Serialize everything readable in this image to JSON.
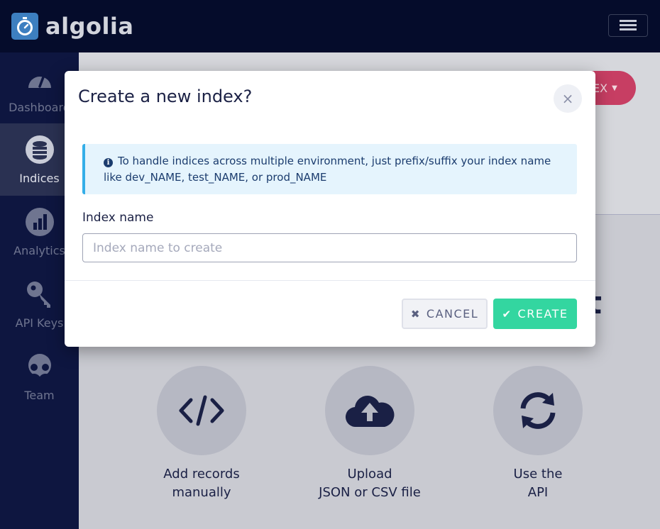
{
  "app": {
    "logo_text": "algolia",
    "menu_icon": "hamburger-menu-icon"
  },
  "sidebar": {
    "items": [
      {
        "label": "Dashboard",
        "icon": "gauge-icon"
      },
      {
        "label": "Indices",
        "icon": "database-icon"
      },
      {
        "label": "Analytics",
        "icon": "bar-chart-icon"
      },
      {
        "label": "API Keys",
        "icon": "key-icon"
      },
      {
        "label": "Team",
        "icon": "users-icon"
      }
    ]
  },
  "background": {
    "new_index_button": "EX",
    "heading_fragment": "t",
    "options": [
      {
        "line1": "Add records",
        "line2": "manually",
        "icon": "code-icon"
      },
      {
        "line1": "Upload",
        "line2": "JSON or CSV file",
        "icon": "cloud-upload-icon"
      },
      {
        "line1": "Use the",
        "line2": "API",
        "icon": "sync-icon"
      }
    ]
  },
  "modal": {
    "title": "Create a new index?",
    "close_label": "×",
    "info_line1": "To handle indices across multiple environment, just prefix/suffix your index name",
    "info_line2": "like dev_NAME, test_NAME, or prod_NAME",
    "field_label": "Index name",
    "input_value": "",
    "input_placeholder": "Index name to create",
    "cancel_label": "CANCEL",
    "create_label": "CREATE"
  },
  "colors": {
    "topbar": "#050c2b",
    "sidebar": "#0e1640",
    "accent_pink": "#c73e63",
    "create_green": "#33d6a0",
    "info_blue": "#34aee8"
  }
}
